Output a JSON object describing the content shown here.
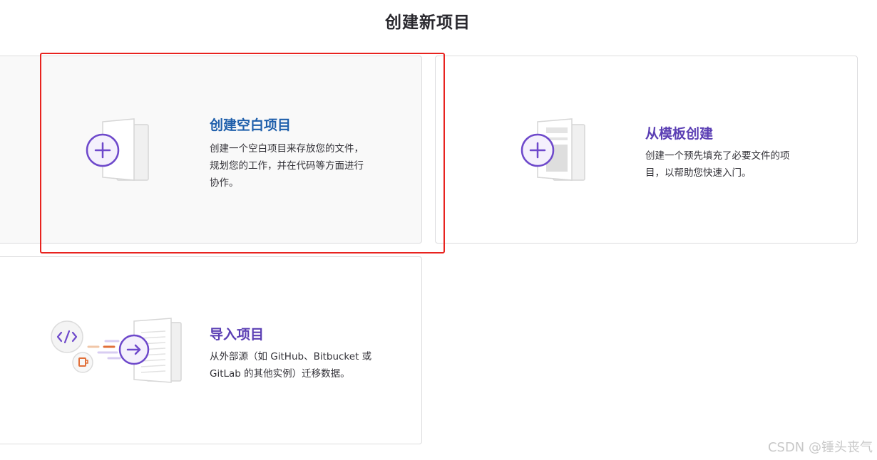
{
  "page": {
    "title": "创建新项目"
  },
  "cards": {
    "blank": {
      "title": "创建空白项目",
      "title_color": "#1f5fab",
      "description_lines": [
        "创建一个空白项目来存放您的文件，",
        "规划您的工作，并在代码等方面进行",
        "协作。"
      ],
      "icon": "plus-icon",
      "selected": true
    },
    "template": {
      "title": "从模板创建",
      "title_color": "#5b3fb4",
      "description_lines": [
        "创建一个预先填充了必要文件的项",
        "目，以帮助您快速入门。"
      ],
      "icon": "plus-icon"
    },
    "import": {
      "title": "导入项目",
      "title_color": "#5b3fb4",
      "description_lines": [
        "从外部源（如 GitHub、Bitbucket 或",
        "GitLab 的其他实例）迁移数据。"
      ],
      "icon": "arrow-right-icon"
    }
  },
  "colors": {
    "accent_purple": "#6e49cb",
    "highlight_red": "#e8231f",
    "card_border": "#dcdcde"
  },
  "watermark": "CSDN @锤头丧气"
}
